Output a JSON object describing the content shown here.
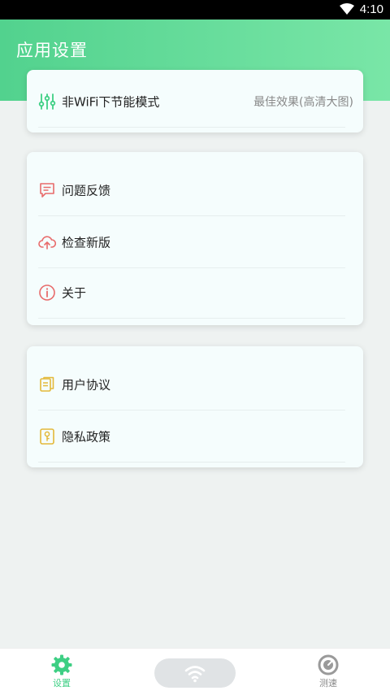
{
  "status": {
    "time": "4:10"
  },
  "header": {
    "title": "应用设置"
  },
  "card1": {
    "items": [
      {
        "label": "非WiFi下节能模式",
        "value": "最佳效果(高清大图)"
      }
    ]
  },
  "card2": {
    "items": [
      {
        "label": "问题反馈"
      },
      {
        "label": "检查新版"
      },
      {
        "label": "关于"
      }
    ]
  },
  "card3": {
    "items": [
      {
        "label": "用户协议"
      },
      {
        "label": "隐私政策"
      }
    ]
  },
  "nav": {
    "settings": "设置",
    "speed": "测速"
  },
  "colors": {
    "accent": "#3ecf84",
    "header_start": "#52d28e",
    "header_end": "#79e6a7",
    "red_icon": "#e86b6b",
    "yellow_icon": "#e3b93a"
  }
}
